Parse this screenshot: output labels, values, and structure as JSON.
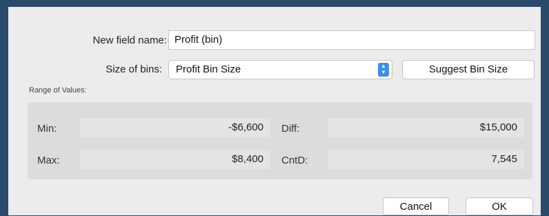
{
  "form": {
    "field_name_label": "New field name:",
    "field_name_value": "Profit (bin)",
    "bin_size_label": "Size of bins:",
    "bin_size_value": "Profit Bin Size",
    "suggest_button": "Suggest Bin Size"
  },
  "range": {
    "title": "Range of Values:",
    "min_label": "Min:",
    "min_value": "-$6,600",
    "max_label": "Max:",
    "max_value": "$8,400",
    "diff_label": "Diff:",
    "diff_value": "$15,000",
    "cntd_label": "CntD:",
    "cntd_value": "7,545"
  },
  "footer": {
    "cancel_label": "Cancel",
    "ok_label": "OK"
  },
  "icons": {
    "stepper": "up-down-chevron-icon"
  },
  "colors": {
    "window_bg": "#2a4a6b",
    "dialog_bg": "#ececec",
    "accent": "#3b8ef0"
  }
}
